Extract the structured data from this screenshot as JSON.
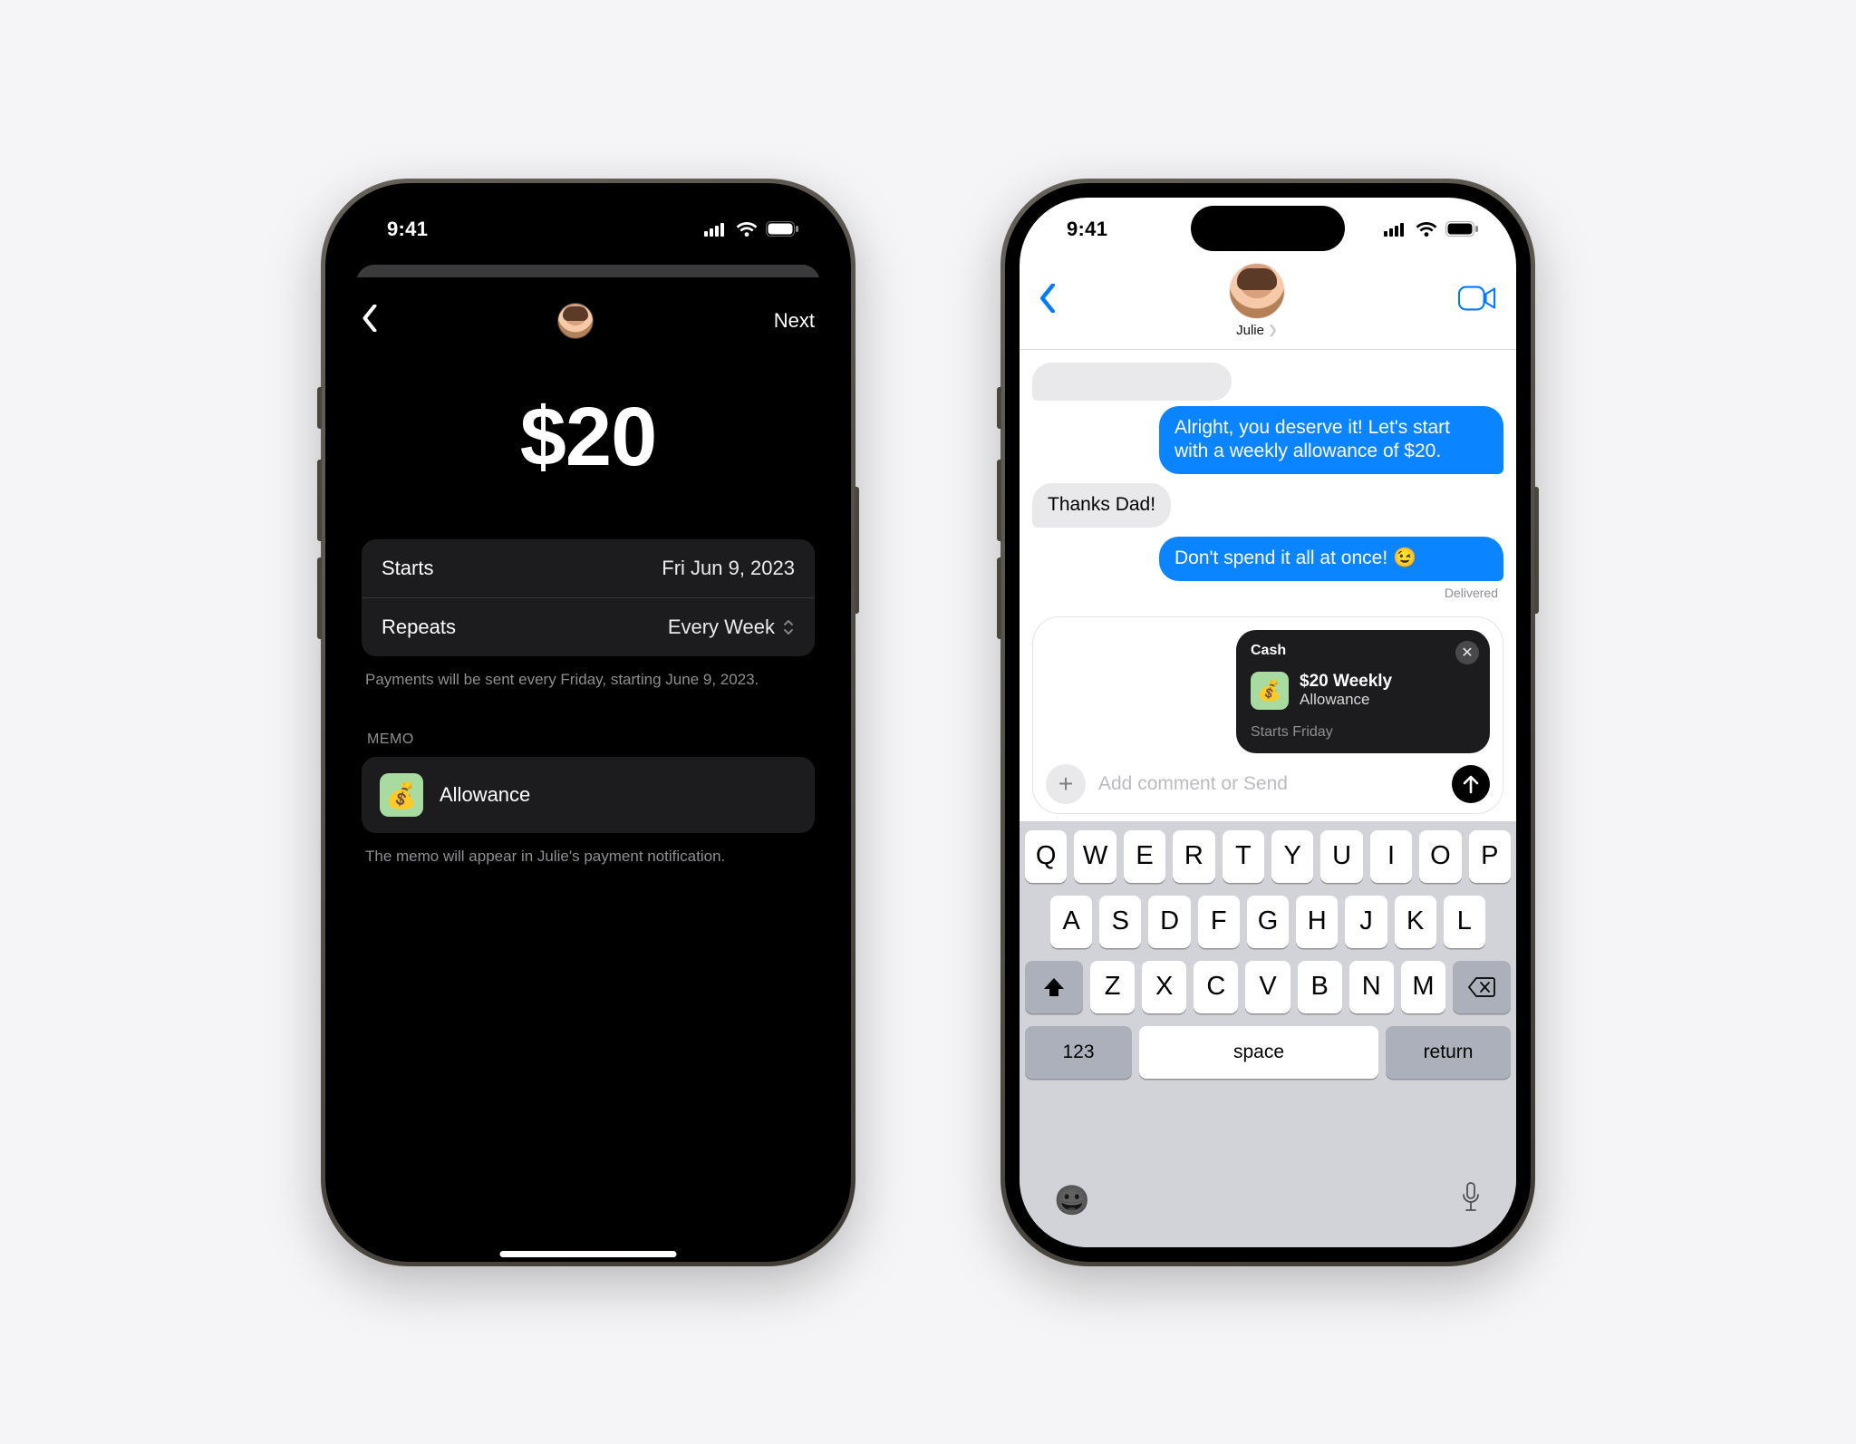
{
  "status": {
    "time": "9:41"
  },
  "screenA": {
    "next": "Next",
    "amount": "$20",
    "starts_label": "Starts",
    "starts_value": "Fri Jun 9, 2023",
    "repeats_label": "Repeats",
    "repeats_value": "Every Week",
    "schedule_note": "Payments will be sent every Friday, starting June 9, 2023.",
    "memo_header": "MEMO",
    "memo_value": "Allowance",
    "memo_note": "The memo will appear in Julie's payment notification."
  },
  "screenB": {
    "contact_name": "Julie",
    "messages": {
      "sent1": "Alright, you deserve it! Let's start with a weekly allowance of $20.",
      "recv1": "Thanks Dad!",
      "sent2": "Don't spend it all at once! 😉"
    },
    "delivered": "Delivered",
    "cash_card": {
      "brand": "Cash",
      "title": "$20 Weekly",
      "subtitle": "Allowance",
      "starts": "Starts Friday"
    },
    "composer_placeholder": "Add comment or Send",
    "keyboard": {
      "row1": [
        "Q",
        "W",
        "E",
        "R",
        "T",
        "Y",
        "U",
        "I",
        "O",
        "P"
      ],
      "row2": [
        "A",
        "S",
        "D",
        "F",
        "G",
        "H",
        "J",
        "K",
        "L"
      ],
      "row3": [
        "Z",
        "X",
        "C",
        "V",
        "B",
        "N",
        "M"
      ],
      "num": "123",
      "space": "space",
      "ret": "return"
    }
  }
}
